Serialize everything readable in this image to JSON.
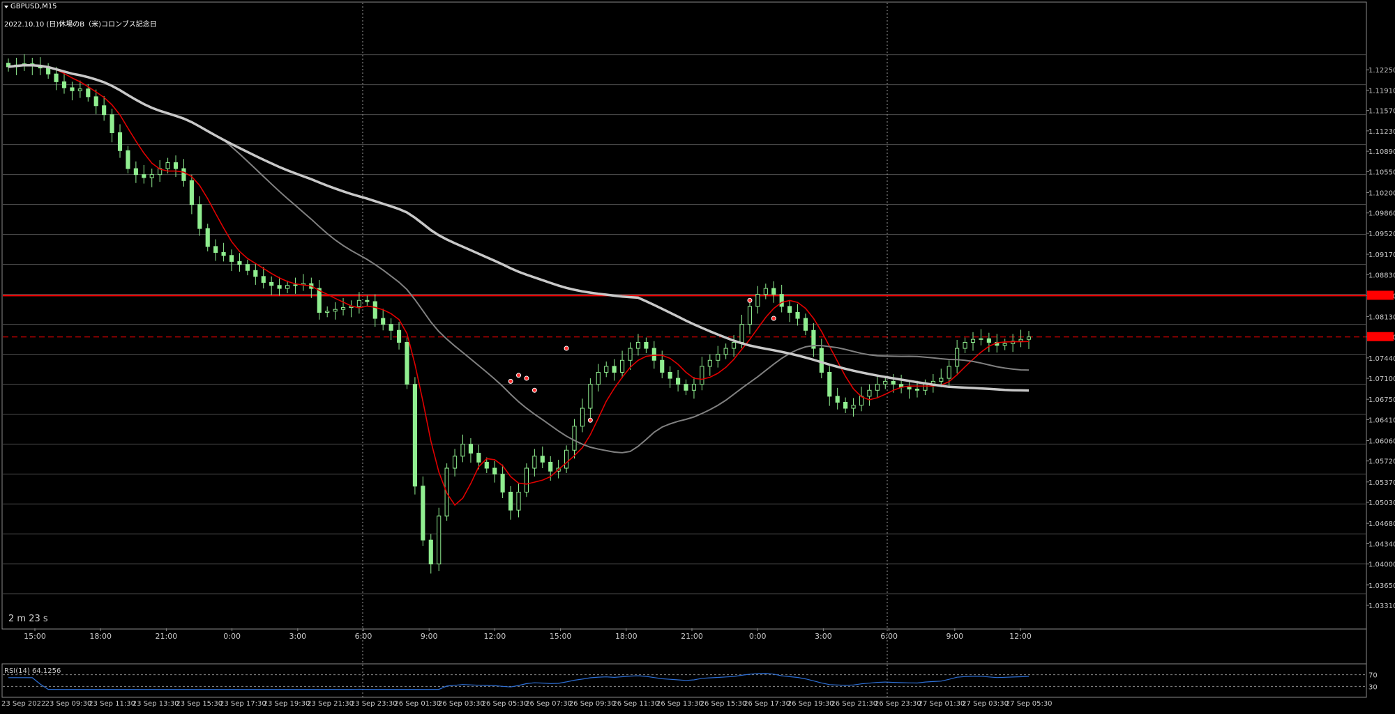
{
  "chart_header": {
    "symbol": "GBPUSD,M15",
    "subtitle": "2022.10.10 (日)休場のB（米)コロンブス記念日"
  },
  "countdown": "2 m 23 s",
  "rsi_label": "RSI(14) 64.1256",
  "colors": {
    "background": "#000000",
    "candle_up": "#90ee90",
    "candle_down": "#ffffff",
    "ma_fast": "#e00000",
    "ma_mid": "#808080",
    "ma_slow": "#c8c8c8",
    "horizontal_line": "#ff0000",
    "rsi_line": "#2d6fd6"
  },
  "chart_data": {
    "type": "line",
    "title": "",
    "xlabel": "",
    "ylabel": "",
    "ylim": [
      1.0331,
      1.1281
    ],
    "price_axis_labels": [
      "1.12250",
      "1.11910",
      "1.11570",
      "1.11230",
      "1.10890",
      "1.10550",
      "1.10200",
      "1.09860",
      "1.09520",
      "1.09170",
      "1.08830",
      "1.08480",
      "1.08130",
      "1.07790",
      "1.07440",
      "1.07100",
      "1.06750",
      "1.06410",
      "1.06060",
      "1.05720",
      "1.05370",
      "1.05030",
      "1.04680",
      "1.04340",
      "1.04000",
      "1.03650",
      "1.03310"
    ],
    "horizontal_lines": [
      {
        "price": 1.0848,
        "style": "solid"
      },
      {
        "price": 1.0779,
        "style": "dashed"
      }
    ],
    "hour_ticks": [
      "15:00",
      "18:00",
      "21:00",
      "0:00",
      "3:00",
      "6:00",
      "9:00",
      "12:00",
      "15:00",
      "18:00",
      "21:00",
      "0:00",
      "3:00",
      "6:00",
      "9:00",
      "12:00"
    ],
    "date_ticks": [
      "23 Sep 2022",
      "23 Sep 09:30",
      "23 Sep 11:30",
      "23 Sep 13:30",
      "23 Sep 15:30",
      "23 Sep 17:30",
      "23 Sep 19:30",
      "23 Sep 21:30",
      "23 Sep 23:30",
      "26 Sep 01:30",
      "26 Sep 03:30",
      "26 Sep 05:30",
      "26 Sep 07:30",
      "26 Sep 09:30",
      "26 Sep 11:30",
      "26 Sep 13:30",
      "26 Sep 15:30",
      "26 Sep 17:30",
      "26 Sep 19:30",
      "26 Sep 21:30",
      "26 Sep 23:30",
      "27 Sep 01:30",
      "27 Sep 03:30",
      "27 Sep 05:30"
    ],
    "rsi_levels": [
      70,
      30
    ],
    "series": [
      {
        "values": [
          1.123,
          1.1233,
          1.1235,
          1.1232,
          1.1228,
          1.1218,
          1.1205,
          1.1195,
          1.119,
          1.1193,
          1.118,
          1.1165,
          1.115,
          1.112,
          1.109,
          1.106,
          1.105,
          1.1045,
          1.105,
          1.106,
          1.107,
          1.106,
          1.104,
          1.1,
          1.096,
          1.093,
          1.092,
          1.0915,
          1.0905,
          1.09,
          1.089,
          1.088,
          1.087,
          1.0865,
          1.086,
          1.0865,
          1.0866,
          1.0868,
          1.086,
          1.082,
          1.0822,
          1.0825,
          1.0828,
          1.083,
          1.084,
          1.0838,
          1.081,
          1.08,
          1.079,
          1.077,
          1.07,
          1.053,
          1.044,
          1.04,
          1.048,
          1.056,
          1.058,
          1.06,
          1.0585,
          1.057,
          1.056,
          1.055,
          1.052,
          1.049,
          1.052,
          1.056,
          1.058,
          1.057,
          1.0555,
          1.056,
          1.059,
          1.063,
          1.066,
          1.07,
          1.072,
          1.073,
          1.072,
          1.074,
          1.076,
          1.077,
          1.076,
          1.074,
          1.072,
          1.071,
          1.07,
          1.069,
          1.07,
          1.073,
          1.074,
          1.075,
          1.076,
          1.077,
          1.08,
          1.083,
          1.085,
          1.086,
          1.085,
          1.083,
          1.082,
          1.081,
          1.079,
          1.076,
          1.072,
          1.068,
          1.067,
          1.066,
          1.0665,
          1.068,
          1.069,
          1.07,
          1.0705,
          1.07,
          1.0695,
          1.0692,
          1.069,
          1.07,
          1.0705,
          1.071,
          1.073,
          1.076,
          1.077,
          1.0775,
          1.0776,
          1.077,
          1.0765,
          1.0768,
          1.0772,
          1.0775,
          1.0779
        ]
      }
    ]
  }
}
